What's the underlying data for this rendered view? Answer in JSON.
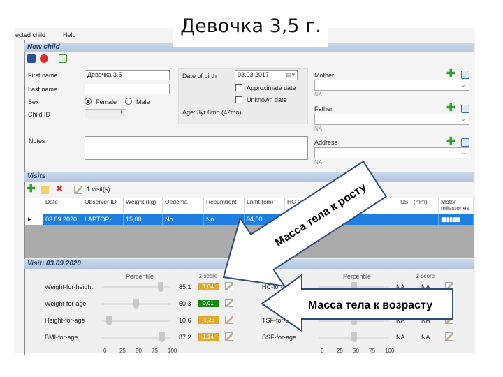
{
  "title": "Девочка 3,5 г.",
  "menu": [
    "ected child",
    "Help"
  ],
  "new_child": {
    "header": "New child",
    "first_name_label": "First name",
    "first_name": "Девочка 3,5",
    "last_name_label": "Last name",
    "last_name": "",
    "sex_label": "Sex",
    "female": "Female",
    "male": "Male",
    "sex_selected": "Female",
    "child_id_label": "Child ID",
    "dob_label": "Date of birth",
    "dob": "03.03.2017",
    "approx_label": "Approximate date",
    "unknown_label": "Unknown date",
    "age": "Age: 3yr 6mo (42mo)",
    "notes_label": "Notes",
    "mother_label": "Mother",
    "father_label": "Father",
    "address_label": "Address",
    "na": "NA"
  },
  "visits": {
    "header": "Visits",
    "count": "1 visit(s)",
    "columns": [
      "Date",
      "Observer ID",
      "Weight (kg)",
      "Oedema",
      "Recumbent",
      "Ln/ht (cm)",
      "HC (cm)",
      "MUAC (cm)",
      "SSF (mm)",
      "Motor milestones"
    ],
    "rows": [
      [
        "03.09.2020",
        "LAPTOP-...",
        "15,00",
        "No",
        "No",
        "94,00",
        "",
        "",
        "",
        ""
      ]
    ],
    "selection_color": "#1e7fe0"
  },
  "visit": {
    "header": "Visit: 03.09.2020",
    "percentile_label": "Percentile",
    "zscore_label": "z-score",
    "left": [
      {
        "label": "Weight-for-height",
        "percentile": 85.1,
        "value": "85,1",
        "z": "1,04",
        "color": "#e3a92a"
      },
      {
        "label": "Weight-for-age",
        "percentile": 50.3,
        "value": "50,3",
        "z": "0,01",
        "color": "#138a13"
      },
      {
        "label": "Height-for-age",
        "percentile": 10.6,
        "value": "10,6",
        "z": "-1,25",
        "color": "#e3a92a"
      },
      {
        "label": "BMI-for-age",
        "percentile": 87.2,
        "value": "87,2",
        "z": "1,14",
        "color": "#e3a92a"
      }
    ],
    "right": [
      {
        "label": "HC-for-age",
        "value": "NA",
        "z": "NA"
      },
      {
        "label": "MUAC-for-age",
        "value": "NA",
        "z": "NA"
      },
      {
        "label": "TSF-for-age",
        "value": "NA",
        "z": "NA"
      },
      {
        "label": "SSF-for-age",
        "value": "NA",
        "z": "NA"
      }
    ],
    "scale": [
      "0",
      "25",
      "50",
      "75",
      "100"
    ]
  },
  "callouts": {
    "height": "Масса тела к росту",
    "age": "Масса тела к возрасту"
  }
}
